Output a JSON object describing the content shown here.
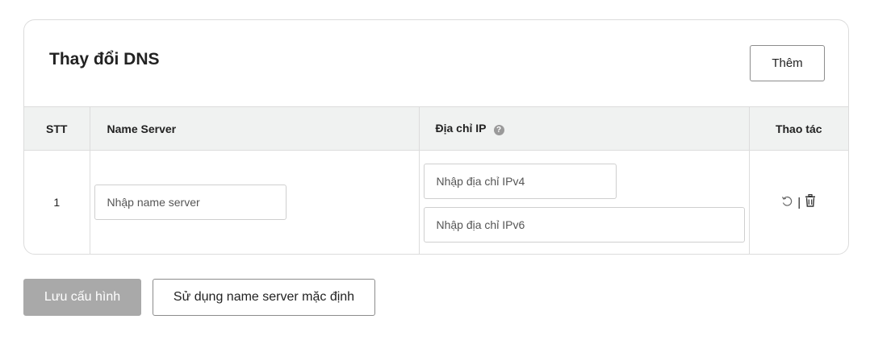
{
  "card": {
    "title": "Thay đổi DNS",
    "add_label": "Thêm"
  },
  "table": {
    "headers": {
      "stt": "STT",
      "name_server": "Name Server",
      "ip": "Địa chỉ IP",
      "actions": "Thao tác"
    },
    "rows": [
      {
        "stt": "1",
        "name_server_value": "",
        "name_server_placeholder": "Nhập name server",
        "ipv4_value": "",
        "ipv4_placeholder": "Nhập địa chỉ IPv4",
        "ipv6_value": "",
        "ipv6_placeholder": "Nhập địa chỉ IPv6",
        "action_separator": "|",
        "action_icons": [
          "undo-icon",
          "trash-icon"
        ]
      }
    ]
  },
  "footer": {
    "save_label": "Lưu cấu hình",
    "default_label": "Sử dụng name server mặc định"
  },
  "colors": {
    "save_disabled_bg": "#a9a9a9",
    "header_bg": "#f0f2f1",
    "border": "#dcdcdc"
  }
}
